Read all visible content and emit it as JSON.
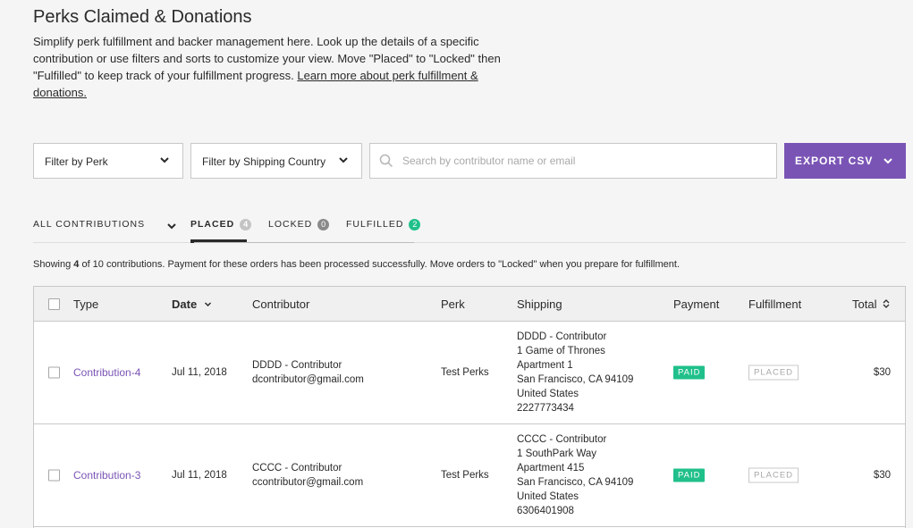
{
  "page": {
    "title": "Perks Claimed & Donations",
    "intro": "Simplify perk fulfillment and backer management here. Look up the details of a specific contribution or use filters and sorts to customize your view. Move \"Placed\" to \"Locked\" then \"Fulfilled\" to keep track of your fulfillment progress. ",
    "intro_link": "Learn more about perk fulfillment & donations."
  },
  "filters": {
    "perk": "Filter by Perk",
    "country": "Filter by Shipping Country",
    "search_placeholder": "Search by contributor name or email",
    "export": "EXPORT CSV"
  },
  "tabs": {
    "all": "ALL CONTRIBUTIONS",
    "placed": "PLACED",
    "placed_count": "4",
    "locked": "LOCKED",
    "locked_count": "0",
    "fulfilled": "FULFILLED",
    "fulfilled_count": "2"
  },
  "summary": {
    "prefix": "Showing ",
    "count": "4",
    "suffix": " of 10 contributions. Payment for these orders has been processed successfully. Move orders to \"Locked\" when you prepare for fulfillment."
  },
  "table": {
    "headers": {
      "type": "Type",
      "date": "Date",
      "contributor": "Contributor",
      "perk": "Perk",
      "shipping": "Shipping",
      "payment": "Payment",
      "fulfillment": "Fulfillment",
      "total": "Total"
    },
    "rows": [
      {
        "type": "Contribution-4",
        "date": "Jul 11, 2018",
        "contributor_name": "DDDD - Contributor",
        "contributor_email": "dcontributor@gmail.com",
        "perk": "Test Perks",
        "shipping": [
          "DDDD - Contributor",
          "1 Game of Thrones",
          "Apartment 1",
          "San Francisco, CA 94109",
          "United States",
          "2227773434"
        ],
        "payment": "PAID",
        "fulfillment": "PLACED",
        "total": "$30"
      },
      {
        "type": "Contribution-3",
        "date": "Jul 11, 2018",
        "contributor_name": "CCCC - Contributor",
        "contributor_email": "ccontributor@gmail.com",
        "perk": "Test Perks",
        "shipping": [
          "CCCC - Contributor",
          "1 SouthPark Way",
          "Apartment 415",
          "San Francisco, CA 94109",
          "United States",
          "6306401908"
        ],
        "payment": "PAID",
        "fulfillment": "PLACED",
        "total": "$30"
      }
    ]
  },
  "colors": {
    "accent": "#7a54b5",
    "paid": "#21c08b",
    "fulfilled_badge": "#21c08b",
    "count_badge": "#9a9a9a"
  },
  "icons": {
    "dropdown": "chevron-down-icon",
    "search": "search-icon",
    "sort": "sort-icon"
  }
}
